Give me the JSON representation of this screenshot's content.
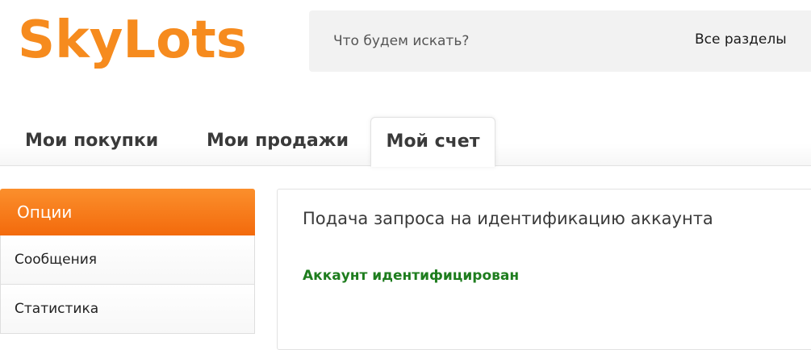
{
  "header": {
    "logo_text": "SkyLots",
    "search": {
      "placeholder": "Что будем искать?",
      "section_label": "Все разделы"
    }
  },
  "tabs": [
    {
      "label": "Мои покупки",
      "active": false
    },
    {
      "label": "Мои продажи",
      "active": false
    },
    {
      "label": "Мой счет",
      "active": true
    }
  ],
  "sidebar": {
    "header": "Опции",
    "items": [
      {
        "label": "Сообщения"
      },
      {
        "label": "Статистика"
      }
    ]
  },
  "main": {
    "title": "Подача запроса на идентификацию аккаунта",
    "status": "Аккаунт идентифицирован"
  },
  "colors": {
    "brand": "#f68b1e",
    "sidebar_header": "#f36a0c",
    "status_success": "#1e7d1e"
  }
}
